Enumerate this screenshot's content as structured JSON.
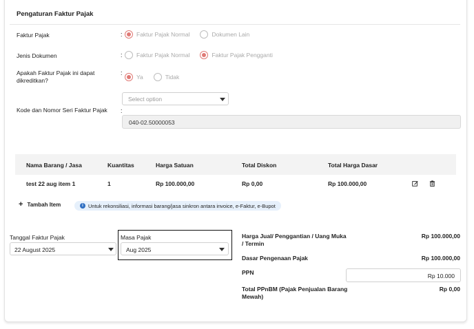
{
  "section": {
    "title": "Pengaturan Faktur Pajak"
  },
  "faktur_pajak": {
    "label": "Faktur Pajak",
    "options": [
      "Faktur Pajak Normal",
      "Dokumen Lain"
    ],
    "selected": 0
  },
  "jenis_dokumen": {
    "label": "Jenis Dokumen",
    "options": [
      "Faktur Pajak Normal",
      "Faktur Pajak Pengganti"
    ],
    "selected": 1
  },
  "dikreditkan": {
    "label_line1": "Apakah Faktur Pajak ini dapat",
    "label_line2": "dikreditkan?",
    "options": [
      "Ya",
      "Tidak"
    ],
    "selected": 0
  },
  "kode_seri": {
    "label": "Kode dan Nomor Seri Faktur Pajak",
    "select_placeholder": "Select option",
    "value": "040-02.50000053"
  },
  "colon": ":",
  "table": {
    "headers": [
      "Nama Barang / Jasa",
      "Kuantitas",
      "Harga Satuan",
      "Total Diskon",
      "Total Harga Dasar"
    ],
    "rows": [
      [
        "test 22 aug item 1",
        "1",
        "Rp 100.000,00",
        "Rp 0,00",
        "Rp 100.000,00"
      ]
    ]
  },
  "add_item": {
    "label": "Tambah Item",
    "icon": "plus-icon"
  },
  "info": {
    "text": "Untuk rekonsiliasi, informasi barang/jasa sinkron antara invoice, e-Faktur, e-Bupot",
    "icon_glyph": "i"
  },
  "tanggal": {
    "label": "Tanggal Faktur Pajak",
    "value": "22 August 2025"
  },
  "masa": {
    "label": "Masa Pajak",
    "value": "Aug 2025"
  },
  "summary": {
    "harga_jual_line1": "Harga Jual/ Penggantian / Uang Muka",
    "harga_jual_line2": "/ Termin",
    "harga_jual_value": "Rp 100.000,00",
    "dpp_label": "Dasar Pengenaan Pajak",
    "dpp_value": "Rp 100.000,00",
    "ppn_label": "PPN",
    "ppn_value": "Rp 10.000",
    "ppnbm_line1": "Total PPnBM (Pajak Penjualan Barang",
    "ppnbm_line2": "Mewah)",
    "ppnbm_value": "Rp 0,00"
  },
  "colors": {
    "radio_checked": "#e07a76",
    "info_bg": "#e6f0fb",
    "info_icon": "#2f6fc2"
  }
}
